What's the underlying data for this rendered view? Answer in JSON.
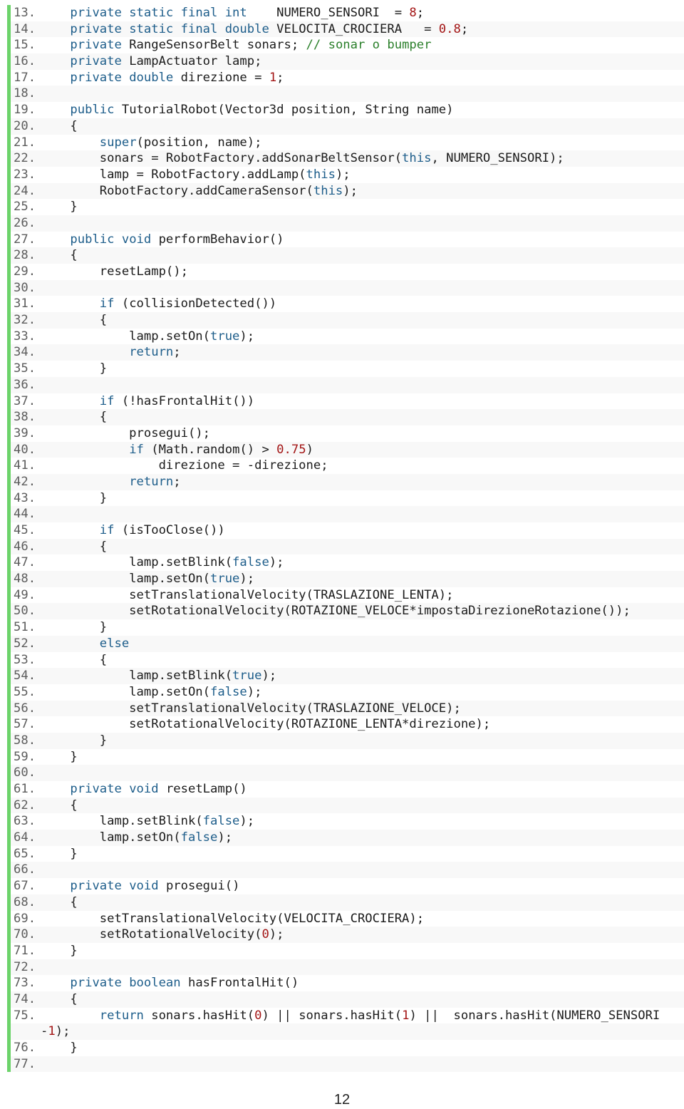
{
  "document": {
    "page_number": "12",
    "accent_bar_color": "#6cd36a",
    "colors": {
      "keyword": "#1d5d8a",
      "number": "#a31515",
      "comment": "#2a7f2a",
      "text": "#1b1b1b",
      "line_number": "#5c5c5c"
    }
  },
  "code_lines": [
    {
      "n": "13.",
      "tokens": [
        [
          "    ",
          ""
        ],
        [
          "private static final int",
          "kw"
        ],
        [
          "    NUMERO_SENSORI  = ",
          ""
        ],
        [
          "8",
          "num"
        ],
        [
          ";",
          ""
        ]
      ]
    },
    {
      "n": "14.",
      "tokens": [
        [
          "    ",
          ""
        ],
        [
          "private static final double",
          "kw"
        ],
        [
          " VELOCITA_CROCIERA   = ",
          ""
        ],
        [
          "0.8",
          "num"
        ],
        [
          ";",
          ""
        ]
      ]
    },
    {
      "n": "15.",
      "tokens": [
        [
          "    ",
          ""
        ],
        [
          "private",
          "kw"
        ],
        [
          " RangeSensorBelt sonars; ",
          ""
        ],
        [
          "// sonar o bumper",
          "cm"
        ]
      ]
    },
    {
      "n": "16.",
      "tokens": [
        [
          "    ",
          ""
        ],
        [
          "private",
          "kw"
        ],
        [
          " LampActuator lamp;",
          ""
        ]
      ]
    },
    {
      "n": "17.",
      "tokens": [
        [
          "    ",
          ""
        ],
        [
          "private double",
          "kw"
        ],
        [
          " direzione = ",
          ""
        ],
        [
          "1",
          "num"
        ],
        [
          ";",
          ""
        ]
      ]
    },
    {
      "n": "18.",
      "tokens": []
    },
    {
      "n": "19.",
      "tokens": [
        [
          "    ",
          ""
        ],
        [
          "public",
          "kw"
        ],
        [
          " TutorialRobot(Vector3d position, String name)",
          ""
        ]
      ]
    },
    {
      "n": "20.",
      "tokens": [
        [
          "    {",
          ""
        ]
      ]
    },
    {
      "n": "21.",
      "tokens": [
        [
          "        ",
          ""
        ],
        [
          "super",
          "kw"
        ],
        [
          "(position, name);",
          ""
        ]
      ]
    },
    {
      "n": "22.",
      "tokens": [
        [
          "        sonars = RobotFactory.addSonarBeltSensor(",
          ""
        ],
        [
          "this",
          "kw"
        ],
        [
          ", NUMERO_SENSORI);",
          ""
        ]
      ]
    },
    {
      "n": "23.",
      "tokens": [
        [
          "        lamp = RobotFactory.addLamp(",
          ""
        ],
        [
          "this",
          "kw"
        ],
        [
          ");",
          ""
        ]
      ]
    },
    {
      "n": "24.",
      "tokens": [
        [
          "        RobotFactory.addCameraSensor(",
          ""
        ],
        [
          "this",
          "kw"
        ],
        [
          ");",
          ""
        ]
      ]
    },
    {
      "n": "25.",
      "tokens": [
        [
          "    }",
          ""
        ]
      ]
    },
    {
      "n": "26.",
      "tokens": []
    },
    {
      "n": "27.",
      "tokens": [
        [
          "    ",
          ""
        ],
        [
          "public void",
          "kw"
        ],
        [
          " performBehavior()",
          ""
        ]
      ]
    },
    {
      "n": "28.",
      "tokens": [
        [
          "    {",
          ""
        ]
      ]
    },
    {
      "n": "29.",
      "tokens": [
        [
          "        resetLamp();",
          ""
        ]
      ]
    },
    {
      "n": "30.",
      "tokens": []
    },
    {
      "n": "31.",
      "tokens": [
        [
          "        ",
          ""
        ],
        [
          "if",
          "kw"
        ],
        [
          " (collisionDetected())",
          ""
        ]
      ]
    },
    {
      "n": "32.",
      "tokens": [
        [
          "        {",
          ""
        ]
      ]
    },
    {
      "n": "33.",
      "tokens": [
        [
          "            lamp.setOn(",
          ""
        ],
        [
          "true",
          "kw"
        ],
        [
          ");",
          ""
        ]
      ]
    },
    {
      "n": "34.",
      "tokens": [
        [
          "            ",
          ""
        ],
        [
          "return",
          "kw"
        ],
        [
          ";",
          ""
        ]
      ]
    },
    {
      "n": "35.",
      "tokens": [
        [
          "        }",
          ""
        ]
      ]
    },
    {
      "n": "36.",
      "tokens": []
    },
    {
      "n": "37.",
      "tokens": [
        [
          "        ",
          ""
        ],
        [
          "if",
          "kw"
        ],
        [
          " (!hasFrontalHit())",
          ""
        ]
      ]
    },
    {
      "n": "38.",
      "tokens": [
        [
          "        {",
          ""
        ]
      ]
    },
    {
      "n": "39.",
      "tokens": [
        [
          "            prosegui();",
          ""
        ]
      ]
    },
    {
      "n": "40.",
      "tokens": [
        [
          "            ",
          ""
        ],
        [
          "if",
          "kw"
        ],
        [
          " (Math.random() > ",
          ""
        ],
        [
          "0.75",
          "num"
        ],
        [
          ")",
          ""
        ]
      ]
    },
    {
      "n": "41.",
      "tokens": [
        [
          "                direzione = -direzione;",
          ""
        ]
      ]
    },
    {
      "n": "42.",
      "tokens": [
        [
          "            ",
          ""
        ],
        [
          "return",
          "kw"
        ],
        [
          ";",
          ""
        ]
      ]
    },
    {
      "n": "43.",
      "tokens": [
        [
          "        }",
          ""
        ]
      ]
    },
    {
      "n": "44.",
      "tokens": []
    },
    {
      "n": "45.",
      "tokens": [
        [
          "        ",
          ""
        ],
        [
          "if",
          "kw"
        ],
        [
          " (isTooClose())",
          ""
        ]
      ]
    },
    {
      "n": "46.",
      "tokens": [
        [
          "        {",
          ""
        ]
      ]
    },
    {
      "n": "47.",
      "tokens": [
        [
          "            lamp.setBlink(",
          ""
        ],
        [
          "false",
          "kw"
        ],
        [
          ");",
          ""
        ]
      ]
    },
    {
      "n": "48.",
      "tokens": [
        [
          "            lamp.setOn(",
          ""
        ],
        [
          "true",
          "kw"
        ],
        [
          ");",
          ""
        ]
      ]
    },
    {
      "n": "49.",
      "tokens": [
        [
          "            setTranslationalVelocity(TRASLAZIONE_LENTA);",
          ""
        ]
      ]
    },
    {
      "n": "50.",
      "tokens": [
        [
          "            setRotationalVelocity(ROTAZIONE_VELOCE*impostaDirezioneRotazione());",
          ""
        ]
      ]
    },
    {
      "n": "51.",
      "tokens": [
        [
          "        }",
          ""
        ]
      ]
    },
    {
      "n": "52.",
      "tokens": [
        [
          "        ",
          ""
        ],
        [
          "else",
          "kw"
        ]
      ]
    },
    {
      "n": "53.",
      "tokens": [
        [
          "        {",
          ""
        ]
      ]
    },
    {
      "n": "54.",
      "tokens": [
        [
          "            lamp.setBlink(",
          ""
        ],
        [
          "true",
          "kw"
        ],
        [
          ");",
          ""
        ]
      ]
    },
    {
      "n": "55.",
      "tokens": [
        [
          "            lamp.setOn(",
          ""
        ],
        [
          "false",
          "kw"
        ],
        [
          ");",
          ""
        ]
      ]
    },
    {
      "n": "56.",
      "tokens": [
        [
          "            setTranslationalVelocity(TRASLAZIONE_VELOCE);",
          ""
        ]
      ]
    },
    {
      "n": "57.",
      "tokens": [
        [
          "            setRotationalVelocity(ROTAZIONE_LENTA*direzione);",
          ""
        ]
      ]
    },
    {
      "n": "58.",
      "tokens": [
        [
          "        }",
          ""
        ]
      ]
    },
    {
      "n": "59.",
      "tokens": [
        [
          "    }",
          ""
        ]
      ]
    },
    {
      "n": "60.",
      "tokens": []
    },
    {
      "n": "61.",
      "tokens": [
        [
          "    ",
          ""
        ],
        [
          "private void",
          "kw"
        ],
        [
          " resetLamp()",
          ""
        ]
      ]
    },
    {
      "n": "62.",
      "tokens": [
        [
          "    {",
          ""
        ]
      ]
    },
    {
      "n": "63.",
      "tokens": [
        [
          "        lamp.setBlink(",
          ""
        ],
        [
          "false",
          "kw"
        ],
        [
          ");",
          ""
        ]
      ]
    },
    {
      "n": "64.",
      "tokens": [
        [
          "        lamp.setOn(",
          ""
        ],
        [
          "false",
          "kw"
        ],
        [
          ");",
          ""
        ]
      ]
    },
    {
      "n": "65.",
      "tokens": [
        [
          "    }",
          ""
        ]
      ]
    },
    {
      "n": "66.",
      "tokens": []
    },
    {
      "n": "67.",
      "tokens": [
        [
          "    ",
          ""
        ],
        [
          "private void",
          "kw"
        ],
        [
          " prosegui()",
          ""
        ]
      ]
    },
    {
      "n": "68.",
      "tokens": [
        [
          "    {",
          ""
        ]
      ]
    },
    {
      "n": "69.",
      "tokens": [
        [
          "        setTranslationalVelocity(VELOCITA_CROCIERA);",
          ""
        ]
      ]
    },
    {
      "n": "70.",
      "tokens": [
        [
          "        setRotationalVelocity(",
          ""
        ],
        [
          "0",
          "num"
        ],
        [
          ");",
          ""
        ]
      ]
    },
    {
      "n": "71.",
      "tokens": [
        [
          "    }",
          ""
        ]
      ]
    },
    {
      "n": "72.",
      "tokens": []
    },
    {
      "n": "73.",
      "tokens": [
        [
          "    ",
          ""
        ],
        [
          "private boolean",
          "kw"
        ],
        [
          " hasFrontalHit()",
          ""
        ]
      ]
    },
    {
      "n": "74.",
      "tokens": [
        [
          "    {",
          ""
        ]
      ]
    },
    {
      "n": "75.",
      "tokens": [
        [
          "        ",
          ""
        ],
        [
          "return",
          "kw"
        ],
        [
          " sonars.hasHit(",
          ""
        ],
        [
          "0",
          "num"
        ],
        [
          ") || sonars.hasHit(",
          ""
        ],
        [
          "1",
          "num"
        ],
        [
          ") ||  sonars.hasHit(NUMERO_SENSORI",
          ""
        ]
      ]
    },
    {
      "n": "",
      "wrap": true,
      "tokens": [
        [
          "-",
          ""
        ],
        [
          "1",
          "num"
        ],
        [
          ");",
          ""
        ]
      ]
    },
    {
      "n": "76.",
      "tokens": [
        [
          "    }",
          ""
        ]
      ]
    },
    {
      "n": "77.",
      "tokens": []
    }
  ]
}
